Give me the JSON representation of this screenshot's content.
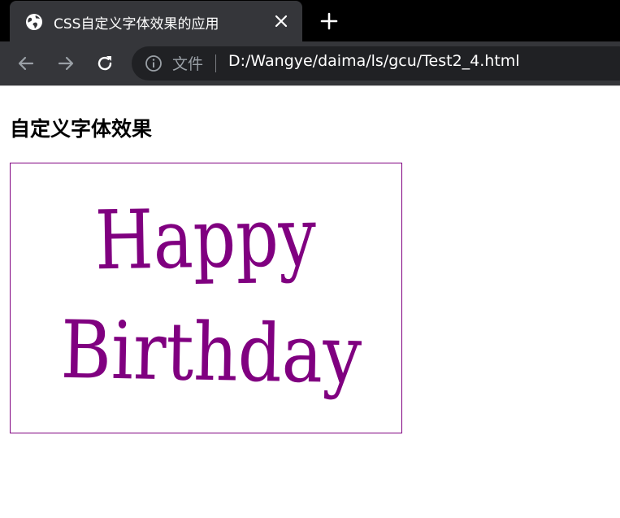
{
  "browser": {
    "tab": {
      "title": "CSS自定义字体效果的应用",
      "favicon": "globe-icon"
    },
    "toolbar": {
      "origin_label": "文件",
      "url": "D:/Wangye/daima/ls/gcu/Test2_4.html"
    },
    "colors": {
      "tabstrip": "#000000",
      "tab": "#35363a",
      "omnibox": "#202124"
    }
  },
  "page": {
    "heading": "自定义字体效果",
    "card": {
      "line1": "Happy",
      "line2": "Birthday",
      "text_color": "#800080",
      "border_color": "#800080"
    }
  }
}
